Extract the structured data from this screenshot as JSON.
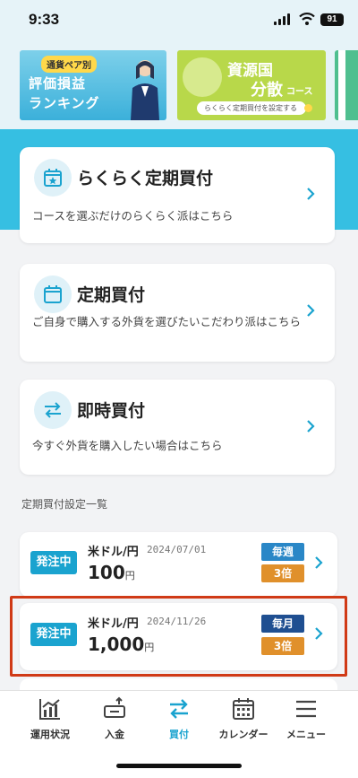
{
  "status_bar": {
    "time": "9:33",
    "battery": "91"
  },
  "banners": {
    "ranking": {
      "tag": "通貨ペア別",
      "line1": "評価損益",
      "line2": "ランキング"
    },
    "diversify": {
      "title": "資源国",
      "big": "分散",
      "suffix": "コース",
      "button": "らくらく定期買付を設定する"
    }
  },
  "actions": [
    {
      "title": "らくらく定期買付",
      "desc": "コースを選ぶだけのらくらく派はこちら",
      "icon": "calendar-star-icon"
    },
    {
      "title": "定期買付",
      "desc": "ご自身で購入する外貨を選びたいこだわり派はこちら",
      "icon": "calendar-icon"
    },
    {
      "title": "即時買付",
      "desc": "今すぐ外貨を購入したい場合はこちら",
      "icon": "exchange-arrows-icon"
    }
  ],
  "section_label": "定期買付設定一覧",
  "orders": [
    {
      "status": "発注中",
      "pair": "米ドル/円",
      "date": "2024/07/01",
      "amount": "100",
      "unit": "円",
      "frequency": "毎週",
      "multiplier": "3倍"
    },
    {
      "status": "発注中",
      "pair": "米ドル/円",
      "date": "2024/11/26",
      "amount": "1,000",
      "unit": "円",
      "frequency": "毎月",
      "multiplier": "3倍"
    }
  ],
  "tabs": [
    {
      "label": "運用状況",
      "icon": "chart-icon",
      "active": false
    },
    {
      "label": "入金",
      "icon": "deposit-icon",
      "active": false
    },
    {
      "label": "買付",
      "icon": "exchange-icon",
      "active": true
    },
    {
      "label": "カレンダー",
      "icon": "calendar-icon",
      "active": false
    },
    {
      "label": "メニュー",
      "icon": "menu-icon",
      "active": false
    }
  ],
  "colors": {
    "accent": "#1aa3cf",
    "hero": "#36bfe2",
    "highlight": "#d03a16",
    "weekly": "#2a87c7",
    "monthly": "#1f4f91",
    "multiplier": "#e0902b"
  }
}
